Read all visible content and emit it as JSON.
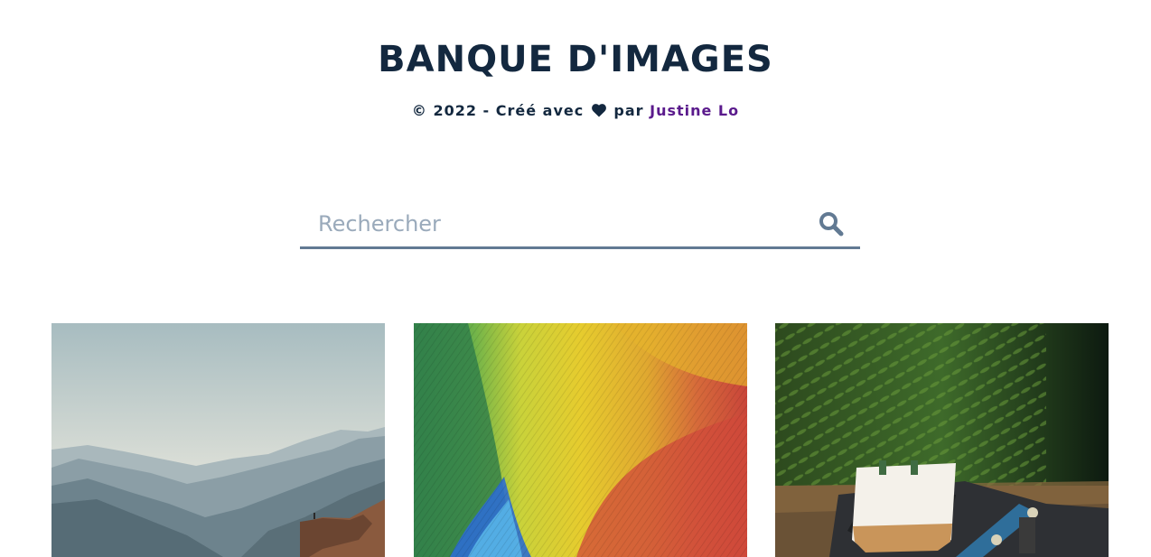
{
  "header": {
    "title": "BANQUE D'IMAGES",
    "credit_prefix": "© 2022 - Créé avec",
    "credit_heart_icon": "heart-icon",
    "credit_by": "par",
    "credit_author": "Justine Lo"
  },
  "search": {
    "placeholder": "Rechercher",
    "value": "",
    "icon": "search-icon"
  },
  "gallery": {
    "images": [
      {
        "subject": "mountains-landscape"
      },
      {
        "subject": "parrot-feathers"
      },
      {
        "subject": "tote-bag-skateboard"
      }
    ]
  },
  "colors": {
    "title": "#13283f",
    "author_link": "#5a1a8c",
    "search_border": "#627a93",
    "placeholder": "#9aaabb"
  }
}
